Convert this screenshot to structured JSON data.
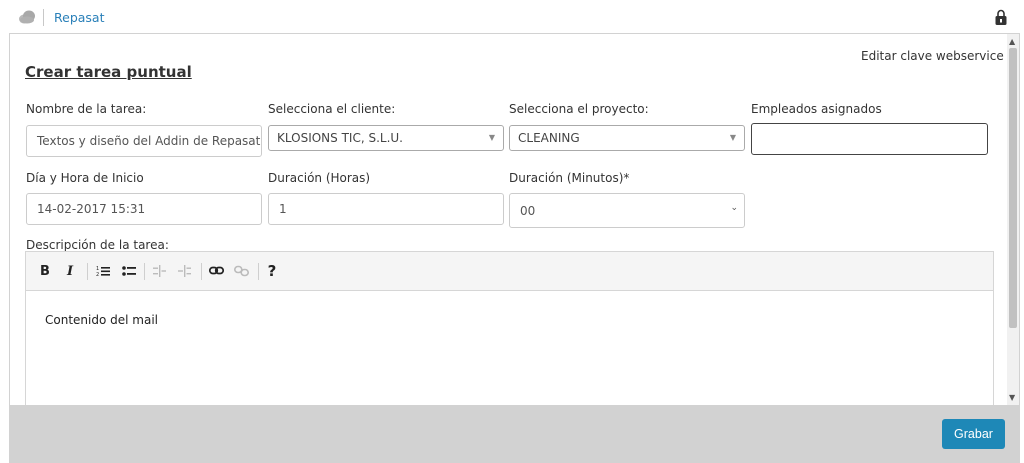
{
  "header": {
    "app_name": "Repasat",
    "logo_icon": "cloud-icon",
    "right_icon": "lock-icon"
  },
  "page": {
    "edit_link": "Editar clave webservice",
    "title": "Crear tarea puntual"
  },
  "form": {
    "task_name": {
      "label": "Nombre de la tarea:",
      "value": "Textos y diseño del Addin de Repasat"
    },
    "client": {
      "label": "Selecciona el cliente:",
      "value": "KLOSIONS TIC, S.L.U."
    },
    "project": {
      "label": "Selecciona el proyecto:",
      "value": "CLEANING"
    },
    "employees": {
      "label": "Empleados asignados",
      "value": ""
    },
    "start": {
      "label": "Día y Hora de Inicio",
      "value": "14-02-2017 15:31"
    },
    "hours": {
      "label": "Duración (Horas)",
      "value": "1"
    },
    "minutes": {
      "label": "Duración (Minutos)*",
      "value": "00"
    },
    "description": {
      "label": "Descripción de la tarea:",
      "content": "Contenido del mail"
    }
  },
  "toolbar": {
    "bold": "B",
    "italic": "I",
    "help": "?"
  },
  "footer": {
    "save_label": "Grabar"
  },
  "colors": {
    "accent": "#1e88b7",
    "link": "#2a80b9",
    "footer_bg": "#d2d2d2"
  }
}
